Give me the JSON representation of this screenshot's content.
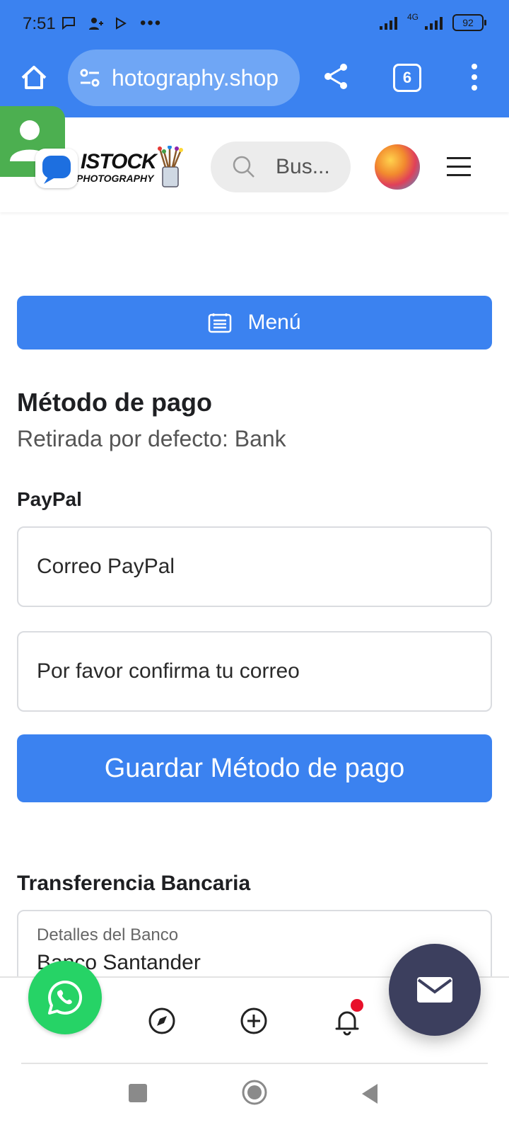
{
  "status_bar": {
    "time": "7:51",
    "network": "4G",
    "battery": "92"
  },
  "browser": {
    "url": "hotography.shop",
    "tab_count": "6"
  },
  "site_header": {
    "logo_text": "ISTOCK",
    "logo_subtext": "PHOTOGRAPHY",
    "search_placeholder": "Bus..."
  },
  "main": {
    "menu_button": "Menú",
    "section_title": "Método de pago",
    "section_subtitle": "Retirada por defecto: Bank",
    "paypal": {
      "label": "PayPal",
      "email_placeholder": "Correo PayPal",
      "confirm_placeholder": "Por favor confirma tu correo",
      "save_button": "Guardar Método de pago"
    },
    "bank": {
      "label": "Transferencia Bancaria",
      "field_caption": "Detalles del Banco",
      "field_value": "Banco Santander"
    }
  },
  "colors": {
    "accent": "#3b82f0",
    "whatsapp": "#26d366",
    "mail_fab": "#3c3f5e",
    "notification_dot": "#e8102a"
  },
  "icons": [
    "home-icon",
    "tune-icon",
    "share-icon",
    "tabs-icon",
    "more-vert-icon",
    "search-icon",
    "menu-list-icon",
    "compass-icon",
    "add-circle-icon",
    "bell-icon",
    "whatsapp-icon",
    "mail-icon"
  ]
}
